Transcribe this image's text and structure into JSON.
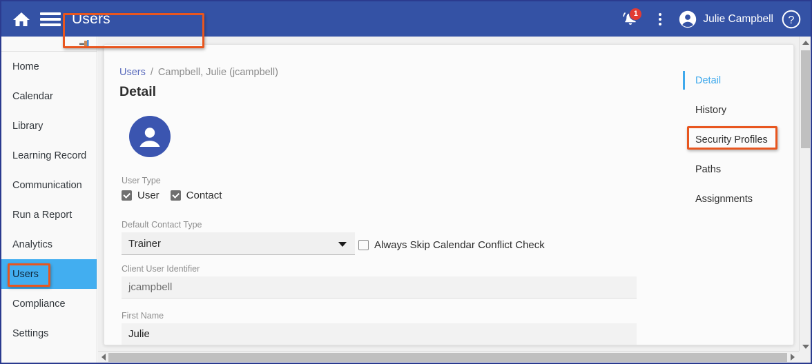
{
  "topbar": {
    "home_icon": "home-icon",
    "menu_icon": "hamburger-menu-icon",
    "title": "Users",
    "notification_icon": "bell-icon",
    "notification_count": "1",
    "overflow_icon": "kebab-menu-icon",
    "avatar_icon": "account-circle-icon",
    "user_name": "Julie Campbell",
    "help_icon": "help-circle-icon"
  },
  "sidebar": {
    "pin_icon": "pin-icon",
    "items": [
      {
        "label": "Home",
        "active": false
      },
      {
        "label": "Calendar",
        "active": false
      },
      {
        "label": "Library",
        "active": false
      },
      {
        "label": "Learning Record",
        "active": false
      },
      {
        "label": "Communication",
        "active": false
      },
      {
        "label": "Run a Report",
        "active": false
      },
      {
        "label": "Analytics",
        "active": false
      },
      {
        "label": "Users",
        "active": true
      },
      {
        "label": "Compliance",
        "active": false
      },
      {
        "label": "Settings",
        "active": false
      }
    ]
  },
  "breadcrumb": {
    "root": "Users",
    "separator": "/",
    "current": "Campbell, Julie (jcampbell)"
  },
  "page": {
    "title": "Detail",
    "avatar_icon": "user-avatar-icon"
  },
  "form": {
    "user_type": {
      "label": "User Type",
      "options": [
        {
          "label": "User",
          "checked": true
        },
        {
          "label": "Contact",
          "checked": true
        }
      ]
    },
    "default_contact_type": {
      "label": "Default Contact Type",
      "value": "Trainer",
      "dropdown_icon": "chevron-down-icon"
    },
    "skip_conflict": {
      "label": "Always Skip Calendar Conflict Check",
      "checked": false
    },
    "client_user_identifier": {
      "label": "Client User Identifier",
      "value": "jcampbell"
    },
    "first_name": {
      "label": "First Name",
      "value": "Julie"
    }
  },
  "rail": {
    "items": [
      {
        "label": "Detail",
        "active": true
      },
      {
        "label": "History",
        "active": false
      },
      {
        "label": "Security Profiles",
        "active": false
      },
      {
        "label": "Paths",
        "active": false
      },
      {
        "label": "Assignments",
        "active": false
      }
    ]
  },
  "annotations": {
    "highlight_color": "#e8561f",
    "targets": [
      "breadcrumb-current",
      "sidebar-item-users",
      "rail-item-security-profiles"
    ]
  },
  "scrollbars": {
    "vertical": {
      "up_icon": "scroll-up-arrow-icon",
      "down_icon": "scroll-down-arrow-icon"
    },
    "horizontal": {
      "left_icon": "scroll-left-arrow-icon",
      "right_icon": "scroll-right-arrow-icon"
    }
  },
  "colors": {
    "topbar": "#3452a5",
    "accent_blue": "#42aef0",
    "badge_red": "#e23b33",
    "avatar_blue": "#3b55b0",
    "link_blue": "#5a6bbd"
  }
}
